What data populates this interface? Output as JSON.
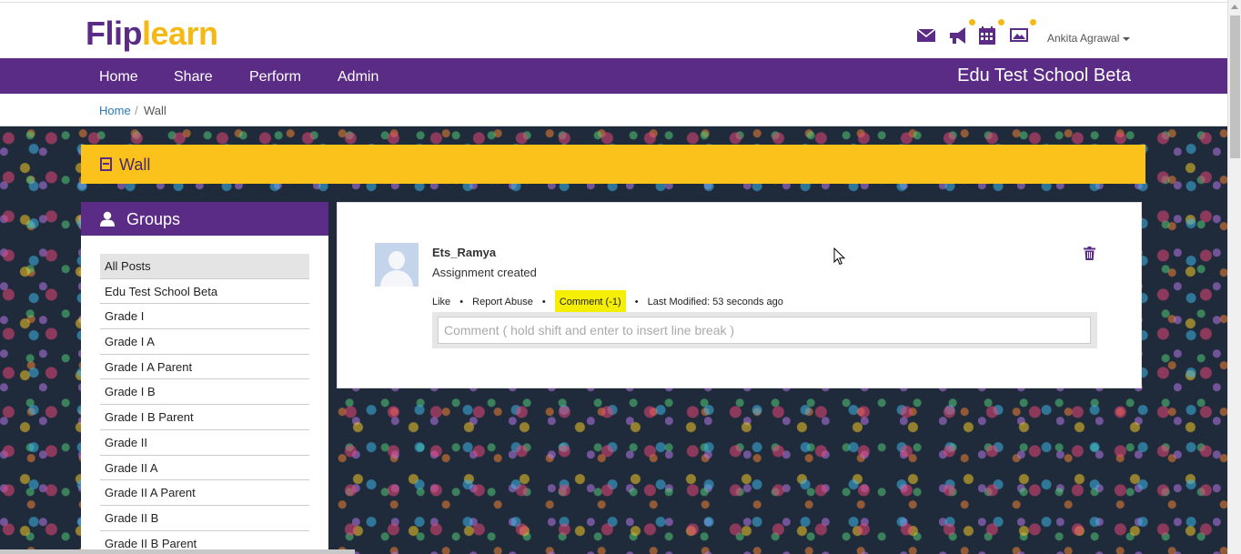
{
  "brand": {
    "logo_part1": "Flip",
    "logo_part2": "learn"
  },
  "header": {
    "icons": [
      "mail-icon",
      "announcement-icon",
      "calendar-icon",
      "gallery-icon"
    ],
    "user_name": "Ankita Agrawal"
  },
  "nav": {
    "items": [
      {
        "label": "Home"
      },
      {
        "label": "Share"
      },
      {
        "label": "Perform"
      },
      {
        "label": "Admin"
      }
    ],
    "school_name": "Edu Test School Beta"
  },
  "breadcrumb": {
    "home": "Home",
    "separator": "/",
    "current": "Wall"
  },
  "wall": {
    "title": "Wall"
  },
  "groups": {
    "title": "Groups",
    "items": [
      "All Posts",
      "Edu Test School Beta",
      "Grade I",
      "Grade I A",
      "Grade I A Parent",
      "Grade I B",
      "Grade I B Parent",
      "Grade II",
      "Grade II A",
      "Grade II A Parent",
      "Grade II B",
      "Grade II B Parent"
    ],
    "active_index": 0
  },
  "post": {
    "author": "Ets_Ramya",
    "text": "Assignment created",
    "like_label": "Like",
    "report_label": "Report Abuse",
    "comment_label": "Comment (-1)",
    "bullet": "•",
    "modified": "Last Modified: 53 seconds ago",
    "comment_placeholder": "Comment ( hold shift and enter to insert line break )"
  },
  "colors": {
    "brand_purple": "#5b2c86",
    "brand_yellow": "#fbc21b",
    "highlight_yellow": "#f5ee05",
    "link_blue": "#2a7ab8"
  }
}
